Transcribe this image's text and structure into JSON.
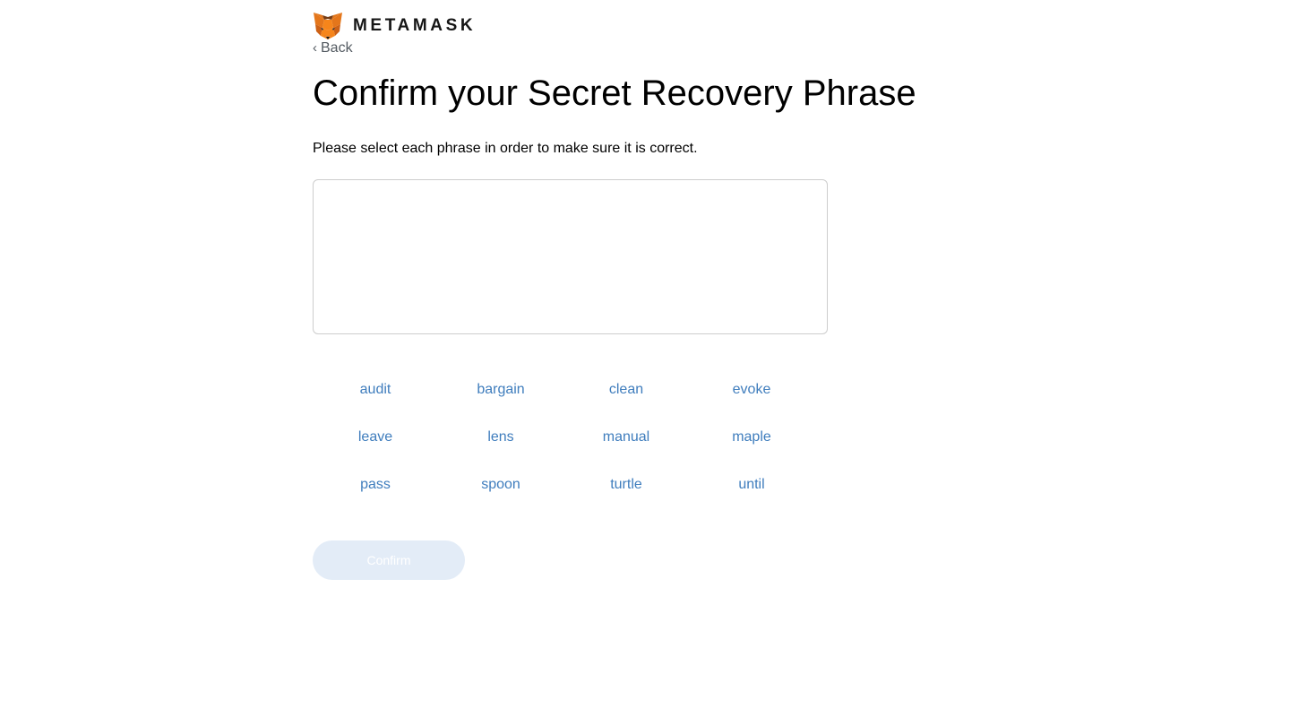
{
  "brand": {
    "name": "METAMASK",
    "logo_icon": "metamask-fox-icon"
  },
  "nav": {
    "back_label": "Back",
    "back_icon": "chevron-left-icon"
  },
  "page": {
    "title": "Confirm your Secret Recovery Phrase",
    "subtitle": "Please select each phrase in order to make sure it is correct."
  },
  "selection": {
    "selected_words": []
  },
  "word_options": [
    "audit",
    "bargain",
    "clean",
    "evoke",
    "leave",
    "lens",
    "manual",
    "maple",
    "pass",
    "spoon",
    "turtle",
    "until"
  ],
  "actions": {
    "confirm_label": "Confirm",
    "confirm_disabled": true
  },
  "colors": {
    "word_link": "#3f7dbd",
    "confirm_disabled_bg": "#e3ecf7",
    "fox_orange": "#e2761b"
  }
}
